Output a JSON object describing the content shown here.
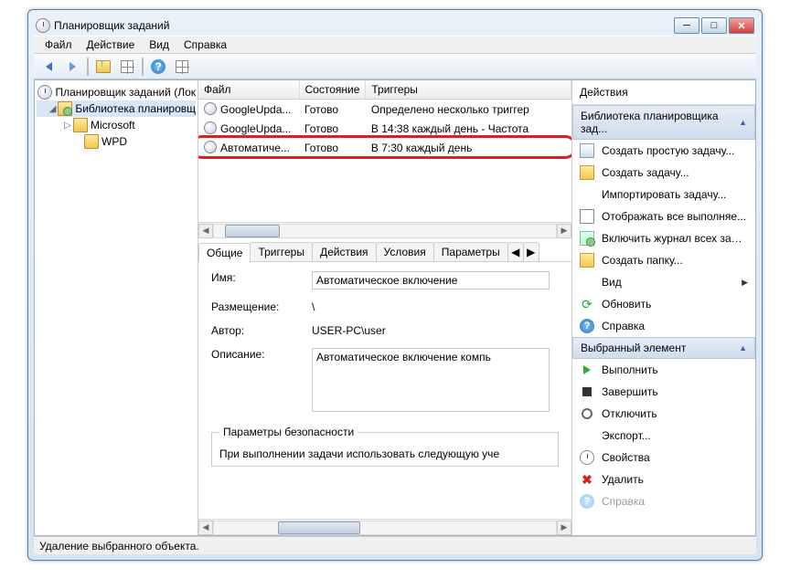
{
  "window": {
    "title": "Планировщик заданий"
  },
  "menu": {
    "file": "Файл",
    "action": "Действие",
    "view": "Вид",
    "help": "Справка"
  },
  "tree": {
    "root": "Планировщик заданий (Лок",
    "lib": "Библиотека планировщ",
    "ms": "Microsoft",
    "wpd": "WPD"
  },
  "list": {
    "cols": {
      "file": "Файл",
      "state": "Состояние",
      "triggers": "Триггеры"
    },
    "rows": [
      {
        "name": "GoogleUpda...",
        "state": "Готово",
        "trig": "Определено несколько триггер"
      },
      {
        "name": "GoogleUpda...",
        "state": "Готово",
        "trig": "В 14:38 каждый день - Частота"
      },
      {
        "name": "Автоматиче...",
        "state": "Готово",
        "trig": "В 7:30 каждый день"
      }
    ]
  },
  "tabs": {
    "general": "Общие",
    "triggers": "Триггеры",
    "actions": "Действия",
    "conditions": "Условия",
    "params": "Параметры"
  },
  "details": {
    "name_lbl": "Имя:",
    "name_val": "Автоматическое включение",
    "loc_lbl": "Размещение:",
    "loc_val": "\\",
    "author_lbl": "Автор:",
    "author_val": "USER-PC\\user",
    "desc_lbl": "Описание:",
    "desc_val": "Автоматическое включение компь",
    "sec_title": "Параметры безопасности",
    "sec_line": "При выполнении задачи использовать следующую уче"
  },
  "actions": {
    "title": "Действия",
    "g1": "Библиотека планировщика зад...",
    "a1": "Создать простую задачу...",
    "a2": "Создать задачу...",
    "a3": "Импортировать задачу...",
    "a4": "Отображать все выполняе...",
    "a5": "Включить журнал всех зада...",
    "a6": "Создать папку...",
    "a7": "Вид",
    "a8": "Обновить",
    "a9": "Справка",
    "g2": "Выбранный элемент",
    "b1": "Выполнить",
    "b2": "Завершить",
    "b3": "Отключить",
    "b4": "Экспорт...",
    "b5": "Свойства",
    "b6": "Удалить",
    "b7": "Справка"
  },
  "status": "Удаление выбранного объекта."
}
